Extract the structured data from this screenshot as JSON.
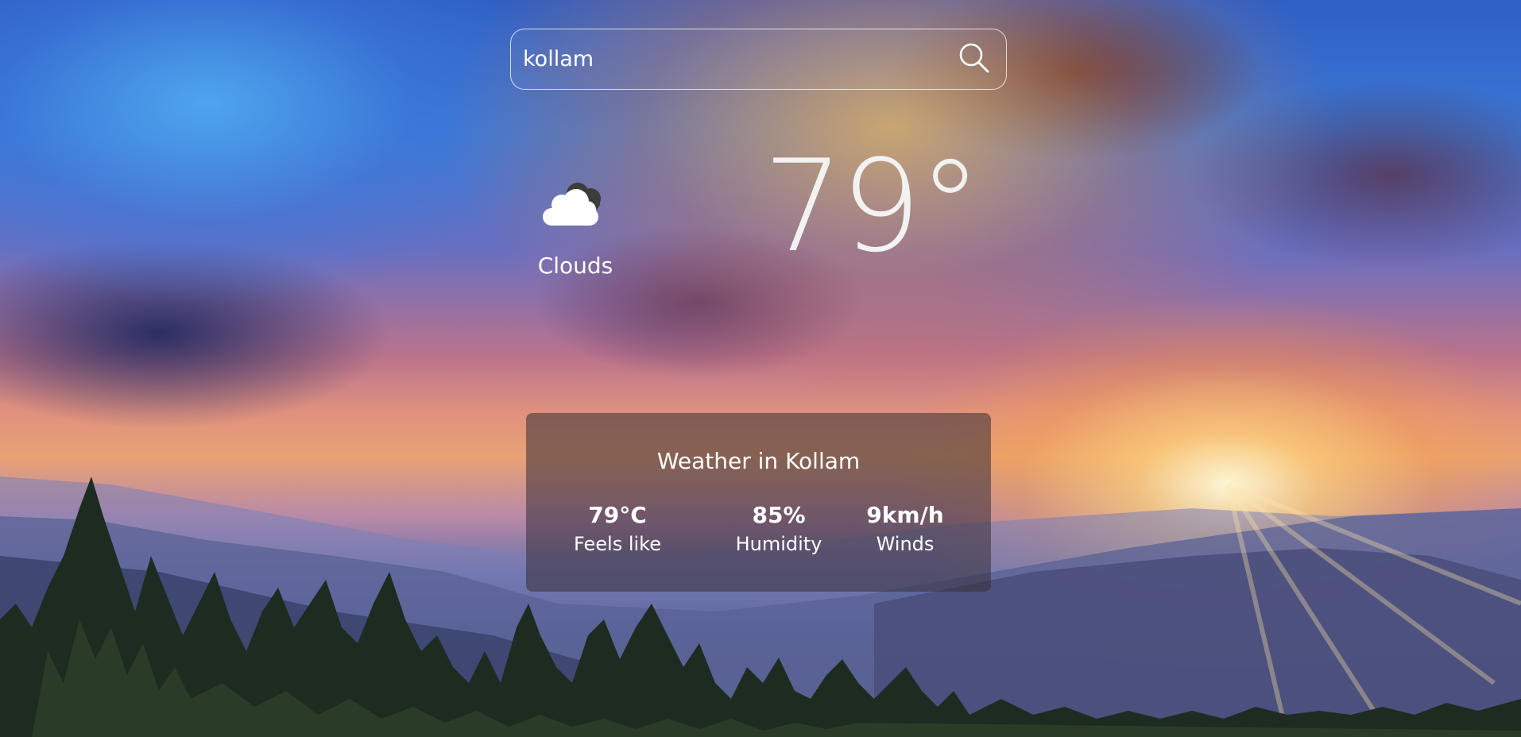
{
  "search": {
    "value": "kollam"
  },
  "current": {
    "condition": "Clouds",
    "condition_icon": "clouds-icon",
    "temperature": "79°"
  },
  "details": {
    "title": "Weather in Kollam",
    "stats": [
      {
        "value": "79°C",
        "label": "Feels like"
      },
      {
        "value": "85%",
        "label": "Humidity"
      },
      {
        "value": "9km/h",
        "label": "Winds"
      }
    ]
  }
}
